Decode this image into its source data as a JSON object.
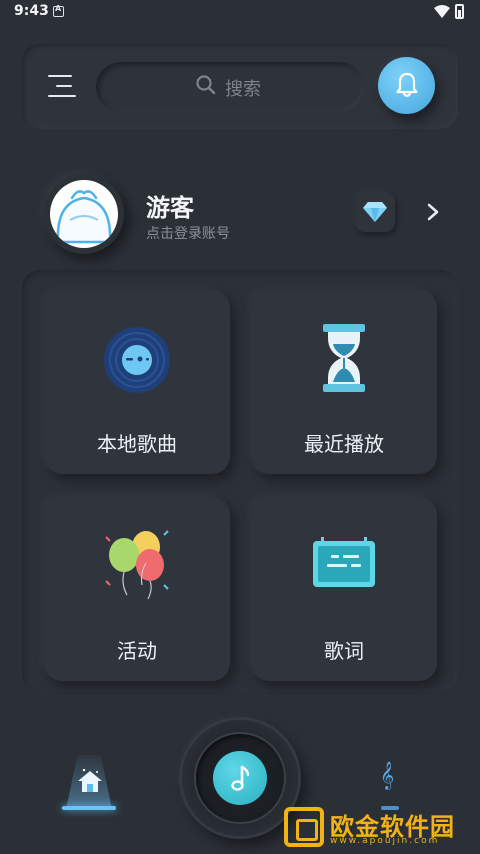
{
  "status_bar": {
    "time": "9:43"
  },
  "header": {
    "search_placeholder": "搜索"
  },
  "profile": {
    "name": "游客",
    "subtitle": "点击登录账号"
  },
  "tiles": [
    {
      "label": "本地歌曲",
      "icon": "vinyl-record-icon"
    },
    {
      "label": "最近播放",
      "icon": "hourglass-icon"
    },
    {
      "label": "活动",
      "icon": "balloons-icon"
    },
    {
      "label": "歌词",
      "icon": "lyrics-screen-icon"
    }
  ],
  "bottom_nav": {
    "home_icon": "home-icon",
    "play_icon": "music-note-icon",
    "music_icon": "treble-clef-icon",
    "clef_glyph": "𝄞"
  },
  "watermark": {
    "text": "欧金软件园",
    "url": "www.apoujin.com"
  },
  "colors": {
    "background": "#2b3037",
    "accent": "#5bb8e9",
    "play_accent": "#39bccd",
    "watermark": "#f3b316"
  }
}
